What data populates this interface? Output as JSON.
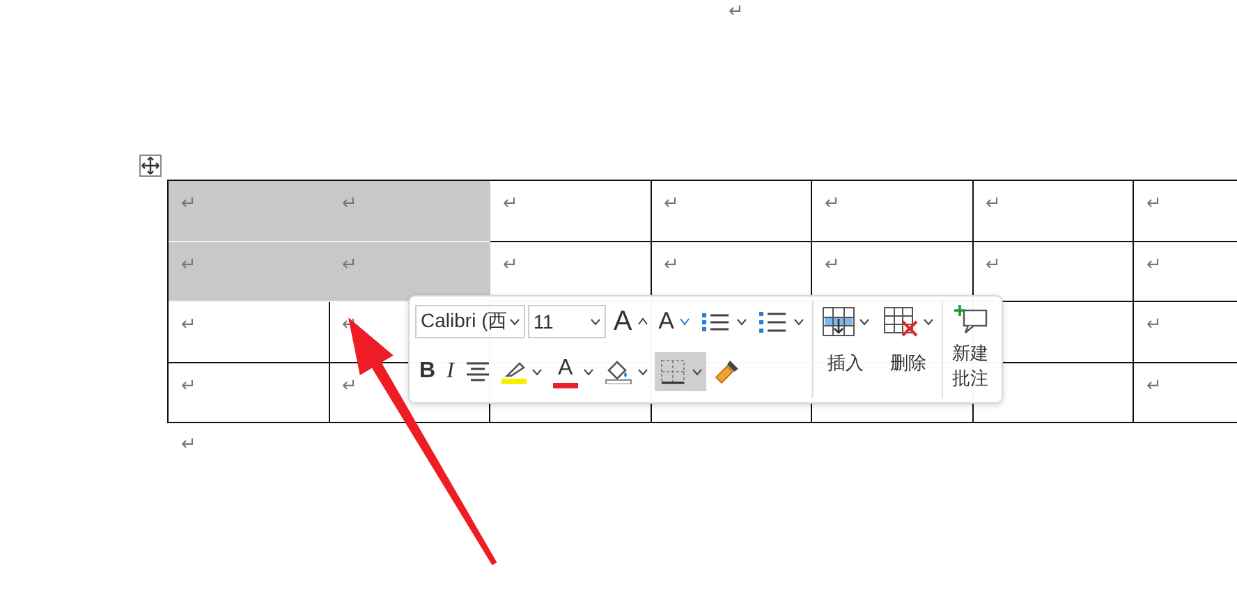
{
  "document": {
    "top_mark": "↵",
    "after_table_mark": "↵"
  },
  "table": {
    "rows": [
      {
        "cells": [
          {
            "text": "↵",
            "selected": true
          },
          {
            "text": "↵",
            "selected": true
          },
          {
            "text": "↵",
            "selected": false
          },
          {
            "text": "↵",
            "selected": false
          },
          {
            "text": "↵",
            "selected": false
          },
          {
            "text": "↵",
            "selected": false
          },
          {
            "text": "↵",
            "selected": false
          }
        ]
      },
      {
        "cells": [
          {
            "text": "↵",
            "selected": true
          },
          {
            "text": "↵",
            "selected": true
          },
          {
            "text": "↵",
            "selected": false
          },
          {
            "text": "↵",
            "selected": false
          },
          {
            "text": "↵",
            "selected": false
          },
          {
            "text": "↵",
            "selected": false
          },
          {
            "text": "↵",
            "selected": false
          }
        ]
      },
      {
        "cells": [
          {
            "text": "↵",
            "selected": false
          },
          {
            "text": "↵",
            "selected": false
          },
          {},
          {},
          {},
          {},
          {
            "text": "↵",
            "selected": false
          }
        ]
      },
      {
        "cells": [
          {
            "text": "↵",
            "selected": false
          },
          {
            "text": "↵",
            "selected": false
          },
          {},
          {},
          {},
          {},
          {
            "text": "↵",
            "selected": false
          }
        ]
      }
    ]
  },
  "mini_toolbar": {
    "font": {
      "value": "Calibri (西"
    },
    "size": {
      "value": "11"
    },
    "row1": [
      {
        "kind": "grow_font",
        "label": "A",
        "dropdown": false
      },
      {
        "kind": "shrink_font",
        "label": "A",
        "dropdown": false
      },
      {
        "kind": "bullets",
        "dropdown": true
      },
      {
        "kind": "numbering",
        "dropdown": true
      }
    ],
    "row2": [
      {
        "kind": "bold",
        "label": "B",
        "dropdown": false,
        "selected": false
      },
      {
        "kind": "italic",
        "label": "I",
        "dropdown": false,
        "selected": false
      },
      {
        "kind": "align",
        "dropdown": false,
        "selected": false
      },
      {
        "kind": "highlight",
        "color": "#f5f000",
        "dropdown": true,
        "selected": false
      },
      {
        "kind": "font_color",
        "label": "A",
        "color": "#e8202a",
        "dropdown": true,
        "selected": false
      },
      {
        "kind": "shading",
        "dropdown": true,
        "selected": false
      },
      {
        "kind": "borders",
        "dropdown": true,
        "selected": true
      },
      {
        "kind": "format_painter",
        "dropdown": false,
        "selected": false
      }
    ],
    "table_actions": [
      {
        "kind": "insert",
        "label": "插入"
      },
      {
        "kind": "delete",
        "label": "删除"
      }
    ],
    "comment": {
      "label": "新建批注"
    }
  }
}
